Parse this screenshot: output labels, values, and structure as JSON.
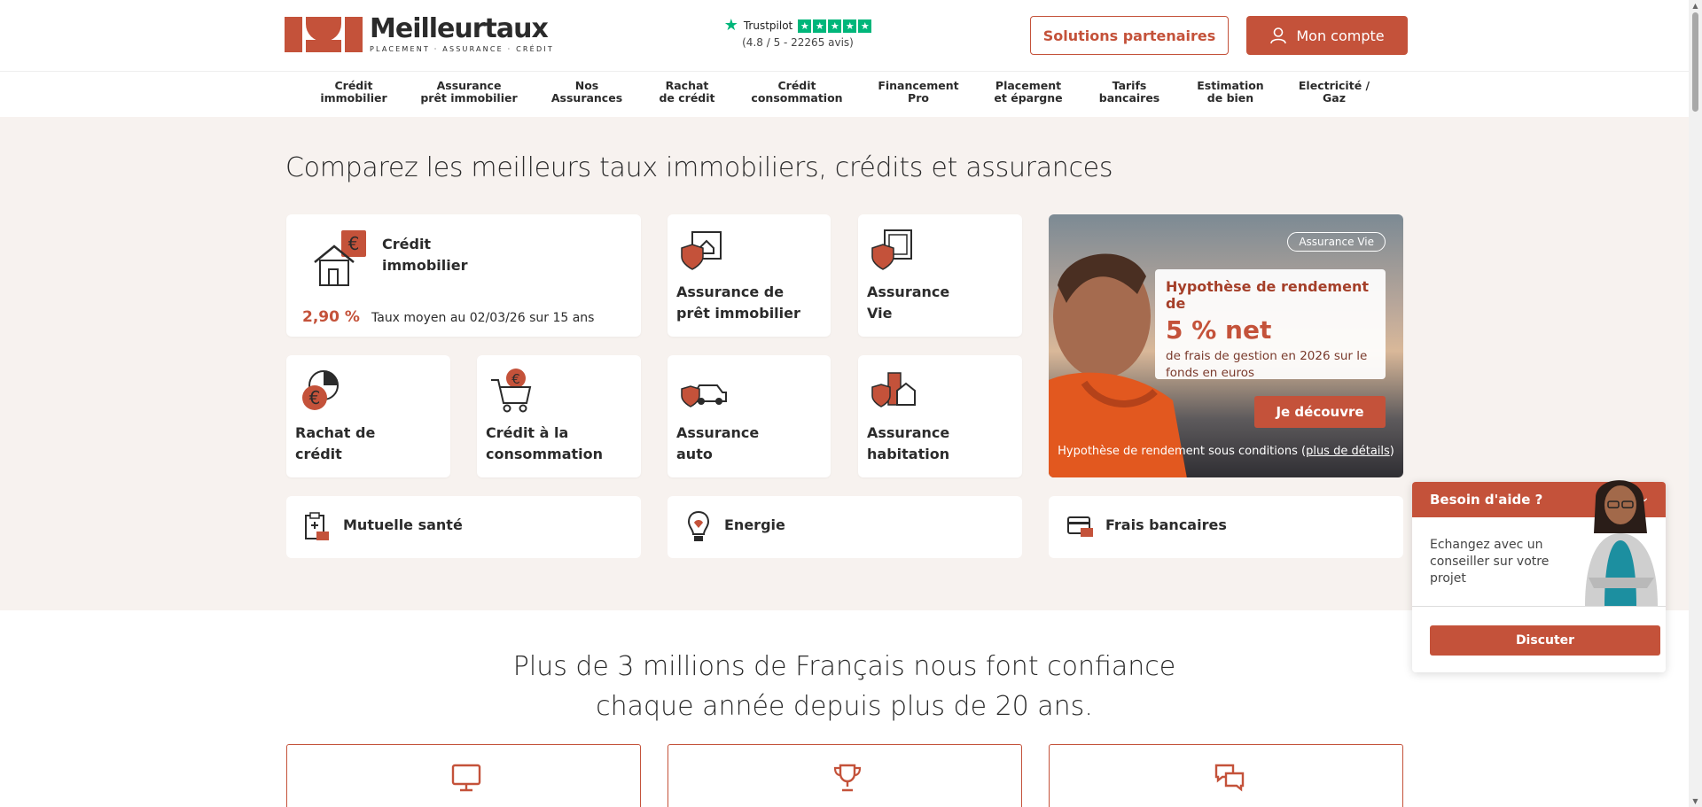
{
  "header": {
    "logo": {
      "name": "Meilleurtaux",
      "tagline": "PLACEMENT · ASSURANCE · CRÉDIT"
    },
    "trustpilot": {
      "label": "Trustpilot",
      "score": "(4.8 / 5 - 22265 avis)"
    },
    "partners_button": "Solutions partenaires",
    "account_button": "Mon compte"
  },
  "nav": [
    {
      "line1": "Crédit",
      "line2": "immobilier"
    },
    {
      "line1": "Assurance",
      "line2": "prêt immobilier"
    },
    {
      "line1": "Nos",
      "line2": "Assurances"
    },
    {
      "line1": "Rachat",
      "line2": "de crédit"
    },
    {
      "line1": "Crédit",
      "line2": "consommation"
    },
    {
      "line1": "Financement",
      "line2": "Pro"
    },
    {
      "line1": "Placement",
      "line2": "et épargne"
    },
    {
      "line1": "Tarifs",
      "line2": "bancaires"
    },
    {
      "line1": "Estimation",
      "line2": "de bien"
    },
    {
      "line1": "Electricité /",
      "line2": "Gaz"
    }
  ],
  "hero": {
    "title": "Comparez les meilleurs taux immobiliers, crédits et assurances",
    "cards": {
      "credit_immo": {
        "line1": "Crédit",
        "line2": "immobilier",
        "rate": "2,90 %",
        "rate_text": "Taux moyen au 02/03/26 sur 15 ans"
      },
      "assurance_pret": {
        "line1": "Assurance de",
        "line2": "prêt immobilier"
      },
      "assurance_vie": {
        "line1": "Assurance",
        "line2": "Vie"
      },
      "rachat": {
        "line1": "Rachat de",
        "line2": "crédit"
      },
      "conso": {
        "line1": "Crédit à la",
        "line2": "consommation"
      },
      "auto": {
        "line1": "Assurance",
        "line2": "auto"
      },
      "habitation": {
        "line1": "Assurance",
        "line2": "habitation"
      }
    },
    "wide": {
      "mutuelle": "Mutuelle santé",
      "energie": "Energie",
      "frais": "Frais bancaires"
    },
    "promo": {
      "badge": "Assurance Vie",
      "line1": "Hypothèse de rendement de",
      "big": "5 % net",
      "line3": "de frais de gestion en 2026 sur le fonds en euros",
      "button": "Je découvre",
      "footer_prefix": "Hypothèse de rendement sous conditions (",
      "footer_link": "plus de détails",
      "footer_suffix": ")"
    }
  },
  "trust": {
    "line1": "Plus de 3 millions de Français nous font confiance",
    "line2": "chaque année depuis plus de 20 ans."
  },
  "chat": {
    "title": "Besoin d'aide ?",
    "text": "Echangez avec un conseiller sur votre projet",
    "button": "Discuter"
  },
  "colors": {
    "brand": "#c4523a",
    "hero_bg": "#f7f2ef",
    "trustpilot": "#00b67a"
  }
}
